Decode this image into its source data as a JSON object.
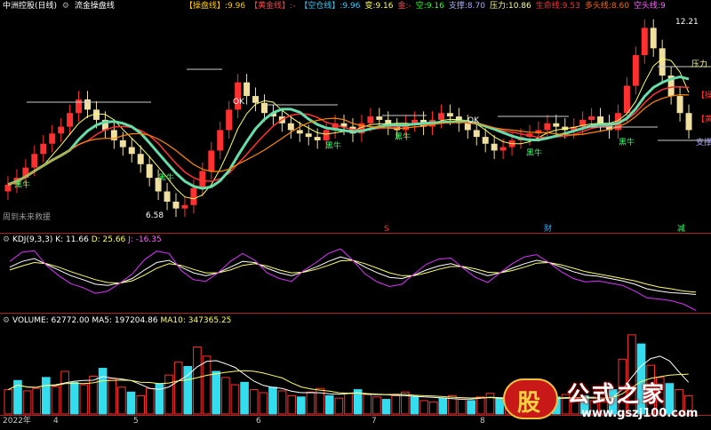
{
  "window": {
    "stock_name": "中洲控股(日线)",
    "formula_name": "流金操盘线",
    "period_start_label": "周到未来救援"
  },
  "main_header": [
    {
      "label": "【操盘线】",
      "value": "9.96",
      "color": "#ffcc00"
    },
    {
      "label": "【黄金线】",
      "value": "-",
      "color": "#ff4444"
    },
    {
      "label": "【空仓线】",
      "value": "9.96",
      "color": "#33ccff"
    },
    {
      "label": "变",
      "value": "9.16",
      "color": "#ffff66"
    },
    {
      "label": "金",
      "value": "-",
      "color": "#ff5555"
    },
    {
      "label": "空",
      "value": "9.16",
      "color": "#33ff33"
    },
    {
      "label": "支撑",
      "value": "8.70",
      "color": "#aaaaff"
    },
    {
      "label": "压力",
      "value": "10.86",
      "color": "#ffff99"
    },
    {
      "label": "生命线",
      "value": "9.53",
      "color": "#ff3333"
    },
    {
      "label": "多头线",
      "value": "8.60",
      "color": "#ff6600"
    },
    {
      "label": "空头线",
      "value": "9",
      "color": "#ff66ff"
    }
  ],
  "kdj_header": {
    "name": "KDJ(9,3,3)",
    "K": "K: 11.66",
    "D": "D: 25.66",
    "J": "J: -16.35"
  },
  "vol_header": {
    "name": "VOLUME: 62772.00",
    "MA5": "MA5: 197204.86",
    "MA10": "MA10: 347365.25"
  },
  "annotations": {
    "high_price": "12.21",
    "low_price": "6.58",
    "pressure": "压力",
    "support": "支撑",
    "caopan": "【操",
    "huangjin": "【黄",
    "heiniu": "黑牛",
    "ok": "OK",
    "cai": "财",
    "jibao": "减",
    "s_mark": "S"
  },
  "xaxis": {
    "year": "2022年",
    "months": [
      "4",
      "5",
      "6",
      "7",
      "8"
    ]
  },
  "logo": {
    "text": "公式之家",
    "url": "www.gszj100.com",
    "badge": "股"
  },
  "chart_data": [
    {
      "type": "candlestick",
      "title": "中洲控股(日线)",
      "ylim": [
        6.3,
        12.4
      ],
      "close": [
        7.4,
        7.6,
        7.9,
        8.3,
        8.6,
        8.9,
        9.1,
        9.5,
        9.9,
        9.6,
        9.3,
        9.0,
        8.7,
        8.5,
        8.3,
        8.0,
        7.6,
        7.2,
        6.9,
        6.7,
        6.8,
        7.3,
        7.8,
        8.4,
        9.0,
        9.6,
        10.4,
        10.0,
        9.8,
        9.5,
        9.4,
        9.2,
        9.0,
        8.9,
        8.8,
        8.7,
        9.0,
        9.2,
        9.1,
        8.9,
        9.2,
        9.4,
        9.3,
        9.1,
        9.0,
        9.2,
        9.3,
        9.1,
        9.3,
        9.5,
        9.4,
        9.2,
        9.0,
        8.8,
        8.6,
        8.4,
        8.5,
        8.7,
        8.8,
        8.9,
        9.0,
        9.2,
        9.1,
        9.0,
        9.1,
        9.3,
        9.4,
        9.2,
        9.0,
        9.5,
        10.3,
        11.2,
        12.0,
        11.4,
        10.6,
        10.0,
        9.5,
        9.0
      ]
    },
    {
      "type": "line",
      "title": "KDJ(9,3,3)",
      "series": [
        {
          "name": "K",
          "values": [
            60,
            70,
            75,
            65,
            55,
            45,
            38,
            30,
            28,
            32,
            40,
            55,
            68,
            72,
            60,
            50,
            45,
            50,
            60,
            70,
            68,
            58,
            50,
            45,
            52,
            60,
            70,
            78,
            72,
            60,
            50,
            42,
            40,
            46,
            55,
            62,
            66,
            60,
            52,
            45,
            50,
            58,
            66,
            72,
            68,
            60,
            52,
            46,
            44,
            40,
            36,
            30,
            22,
            18,
            15,
            14,
            12
          ]
        },
        {
          "name": "D",
          "values": [
            55,
            62,
            68,
            66,
            60,
            52,
            45,
            38,
            33,
            32,
            36,
            46,
            58,
            66,
            63,
            56,
            50,
            50,
            55,
            63,
            66,
            62,
            55,
            50,
            51,
            56,
            63,
            71,
            72,
            66,
            58,
            50,
            45,
            45,
            50,
            56,
            61,
            61,
            57,
            51,
            50,
            54,
            60,
            67,
            68,
            64,
            58,
            52,
            48,
            44,
            40,
            36,
            30,
            25,
            22,
            18,
            16
          ]
        },
        {
          "name": "J",
          "values": [
            70,
            86,
            89,
            63,
            45,
            31,
            24,
            14,
            18,
            32,
            48,
            73,
            88,
            84,
            54,
            38,
            35,
            50,
            70,
            84,
            72,
            50,
            40,
            35,
            54,
            68,
            84,
            92,
            72,
            48,
            34,
            26,
            30,
            48,
            65,
            74,
            76,
            58,
            42,
            33,
            50,
            66,
            78,
            82,
            68,
            52,
            40,
            34,
            36,
            32,
            28,
            18,
            6,
            4,
            1,
            -5,
            -16
          ]
        }
      ]
    },
    {
      "type": "bar",
      "title": "VOLUME",
      "values": [
        40,
        55,
        38,
        42,
        60,
        45,
        70,
        52,
        48,
        62,
        75,
        58,
        44,
        36,
        30,
        42,
        50,
        64,
        85,
        78,
        110,
        95,
        70,
        60,
        48,
        52,
        40,
        35,
        44,
        38,
        30,
        28,
        36,
        42,
        30,
        26,
        34,
        40,
        32,
        28,
        24,
        30,
        36,
        28,
        22,
        20,
        26,
        30,
        24,
        22,
        28,
        34,
        26,
        22,
        30,
        26,
        24,
        20,
        28,
        32,
        26,
        30,
        22,
        20,
        40,
        90,
        130,
        115,
        80,
        60,
        50,
        40,
        30
      ]
    }
  ]
}
